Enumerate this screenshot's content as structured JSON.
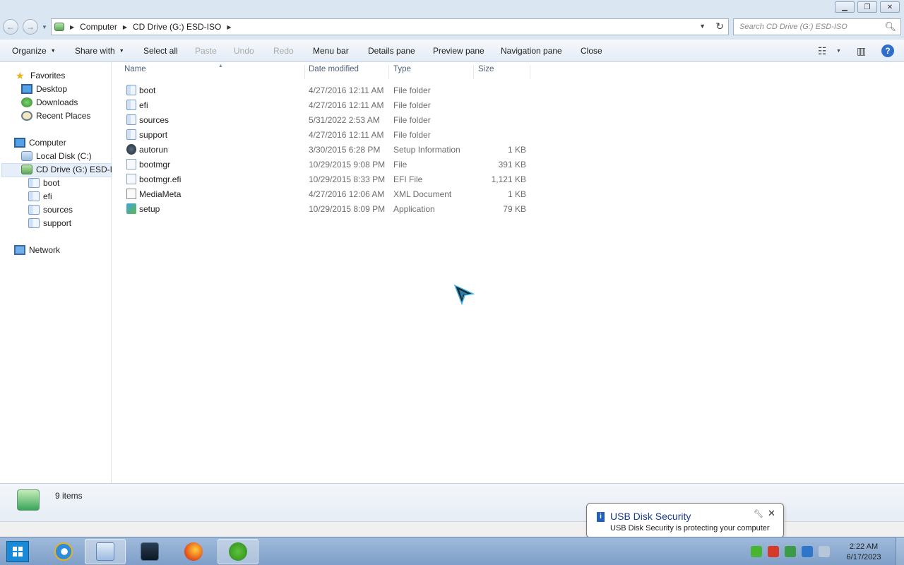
{
  "window": {
    "minimize_icon": "minimize-icon",
    "maximize_icon": "restore-icon",
    "close_icon": "close-icon"
  },
  "address": {
    "crumbs": [
      "Computer",
      "CD Drive (G:) ESD-ISO"
    ],
    "search_placeholder": "Search CD Drive (G:) ESD-ISO"
  },
  "toolbar": {
    "organize": "Organize",
    "share_with": "Share with",
    "select_all": "Select all",
    "paste": "Paste",
    "undo": "Undo",
    "redo": "Redo",
    "menu_bar": "Menu bar",
    "details_pane": "Details pane",
    "preview_pane": "Preview pane",
    "navigation_pane": "Navigation pane",
    "close": "Close"
  },
  "nav": {
    "favorites": "Favorites",
    "desktop": "Desktop",
    "downloads": "Downloads",
    "recent_places": "Recent Places",
    "computer": "Computer",
    "local_disk": "Local Disk (C:)",
    "cd_drive": "CD Drive (G:) ESD-ISO",
    "sub": [
      "boot",
      "efi",
      "sources",
      "support"
    ],
    "network": "Network"
  },
  "columns": {
    "name": "Name",
    "date": "Date modified",
    "type": "Type",
    "size": "Size"
  },
  "files": [
    {
      "name": "boot",
      "date": "4/27/2016 12:11 AM",
      "type": "File folder",
      "size": "",
      "icon": "folder-icon"
    },
    {
      "name": "efi",
      "date": "4/27/2016 12:11 AM",
      "type": "File folder",
      "size": "",
      "icon": "folder-icon"
    },
    {
      "name": "sources",
      "date": "5/31/2022 2:53 AM",
      "type": "File folder",
      "size": "",
      "icon": "folder-icon"
    },
    {
      "name": "support",
      "date": "4/27/2016 12:11 AM",
      "type": "File folder",
      "size": "",
      "icon": "folder-icon"
    },
    {
      "name": "autorun",
      "date": "3/30/2015 6:28 PM",
      "type": "Setup Information",
      "size": "1 KB",
      "icon": "setup-info-icon"
    },
    {
      "name": "bootmgr",
      "date": "10/29/2015 9:08 PM",
      "type": "File",
      "size": "391 KB",
      "icon": "file-icon"
    },
    {
      "name": "bootmgr.efi",
      "date": "10/29/2015 8:33 PM",
      "type": "EFI File",
      "size": "1,121 KB",
      "icon": "file-icon"
    },
    {
      "name": "MediaMeta",
      "date": "4/27/2016 12:06 AM",
      "type": "XML Document",
      "size": "1 KB",
      "icon": "xml-icon"
    },
    {
      "name": "setup",
      "date": "10/29/2015 8:09 PM",
      "type": "Application",
      "size": "79 KB",
      "icon": "setup-app-icon"
    }
  ],
  "details": {
    "count": "9 items"
  },
  "balloon": {
    "title": "USB Disk Security",
    "message": "USB Disk Security is protecting your computer"
  },
  "clock": {
    "time": "2:22 AM",
    "date": "6/17/2023"
  }
}
